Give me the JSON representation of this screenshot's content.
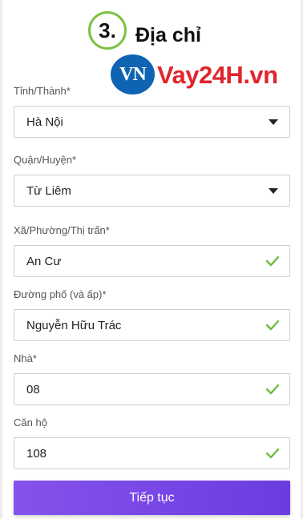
{
  "step": {
    "number": "3.",
    "title": "Địa chỉ"
  },
  "watermark": {
    "badge": "VN",
    "text": "Vay24H.vn"
  },
  "fields": [
    {
      "label": "Tỉnh/Thành*",
      "value": "Hà Nội",
      "control": "select"
    },
    {
      "label": "Quận/Huyện*",
      "value": "Từ Liêm",
      "control": "select"
    },
    {
      "label": "Xã/Phường/Thị trấn*",
      "value": "An Cư",
      "control": "input",
      "status": "valid"
    },
    {
      "label": "Đường phố (và ấp)*",
      "value": "Nguyễn Hữu Trác",
      "control": "input",
      "status": "valid"
    },
    {
      "label": "Nhà*",
      "value": "08",
      "control": "input",
      "status": "valid"
    },
    {
      "label": "Căn hộ",
      "value": "108",
      "control": "input",
      "status": "valid"
    }
  ],
  "submit_label": "Tiếp tục",
  "colors": {
    "accent": "#7b4be8",
    "valid": "#6dbb3c",
    "step_ring": "#7cc242"
  },
  "icons": {
    "select": "chevron-down-icon",
    "valid": "check-icon"
  }
}
